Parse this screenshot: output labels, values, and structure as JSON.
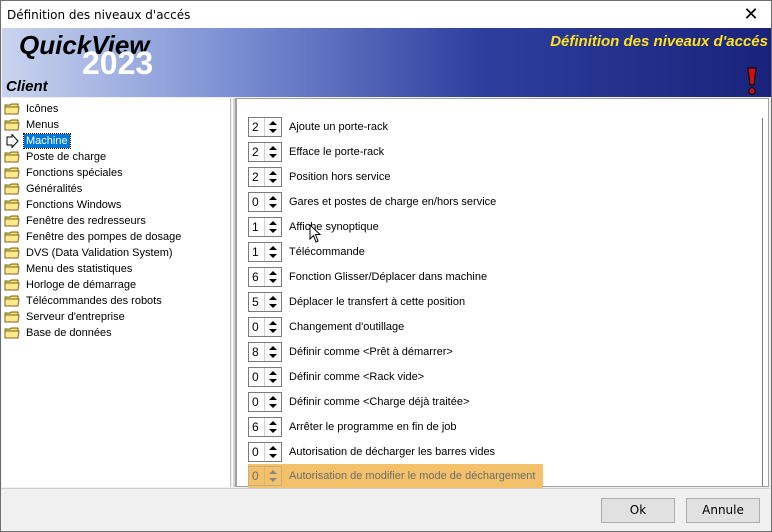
{
  "window": {
    "title": "Définition des niveaux d'accés",
    "close_glyph": "✕"
  },
  "banner": {
    "brand": "QuickView",
    "year": "2023",
    "client": "Client",
    "heading": "Définition des niveaux d'accés",
    "alert_icon": "exclamation-icon",
    "colors": {
      "heading": "#ffe21a",
      "gradient_start": "#c9d4ee",
      "gradient_end": "#1a237b"
    }
  },
  "tree": {
    "items": [
      {
        "label": "Icônes",
        "icon": "folder-icon",
        "selected": false
      },
      {
        "label": "Menus",
        "icon": "folder-icon",
        "selected": false
      },
      {
        "label": "Machine",
        "icon": "arrow-icon",
        "selected": true
      },
      {
        "label": "Poste de charge",
        "icon": "folder-icon",
        "selected": false
      },
      {
        "label": "Fonctions spéciales",
        "icon": "folder-icon",
        "selected": false
      },
      {
        "label": "Généralités",
        "icon": "folder-icon",
        "selected": false
      },
      {
        "label": "Fonctions Windows",
        "icon": "folder-icon",
        "selected": false
      },
      {
        "label": "Fenêtre des redresseurs",
        "icon": "folder-icon",
        "selected": false
      },
      {
        "label": "Fenêtre des pompes de dosage",
        "icon": "folder-icon",
        "selected": false
      },
      {
        "label": "DVS (Data Validation System)",
        "icon": "folder-icon",
        "selected": false
      },
      {
        "label": "Menu des statistiques",
        "icon": "folder-icon",
        "selected": false
      },
      {
        "label": "Horloge de démarrage",
        "icon": "folder-icon",
        "selected": false
      },
      {
        "label": "Télécommandes des robots",
        "icon": "folder-icon",
        "selected": false
      },
      {
        "label": "Serveur d'entreprise",
        "icon": "folder-icon",
        "selected": false
      },
      {
        "label": "Base de données",
        "icon": "folder-icon",
        "selected": false
      }
    ]
  },
  "rights": [
    {
      "value": "2",
      "label": "Ajoute un porte-rack"
    },
    {
      "value": "2",
      "label": "Efface le porte-rack"
    },
    {
      "value": "2",
      "label": "Position hors service"
    },
    {
      "value": "0",
      "label": "Gares et postes de charge en/hors service"
    },
    {
      "value": "1",
      "label": "Affiche synoptique"
    },
    {
      "value": "1",
      "label": "Télécommande"
    },
    {
      "value": "6",
      "label": "Fonction Glisser/Déplacer dans machine"
    },
    {
      "value": "5",
      "label": "Déplacer le transfert à cette position"
    },
    {
      "value": "0",
      "label": "Changement d'outillage"
    },
    {
      "value": "8",
      "label": "Définir comme <Prêt à démarrer>"
    },
    {
      "value": "0",
      "label": "Définir comme <Rack vide>"
    },
    {
      "value": "0",
      "label": "Définir comme <Charge déjà traitée>"
    },
    {
      "value": "6",
      "label": "Arrêter le programme en fin de job"
    },
    {
      "value": "0",
      "label": "Autorisation de décharger les barres vides"
    },
    {
      "value": "0",
      "label": "Autorisation de modifier le mode de déchargement",
      "highlighted": true
    }
  ],
  "buttons": {
    "ok": "Ok",
    "cancel": "Annule"
  }
}
